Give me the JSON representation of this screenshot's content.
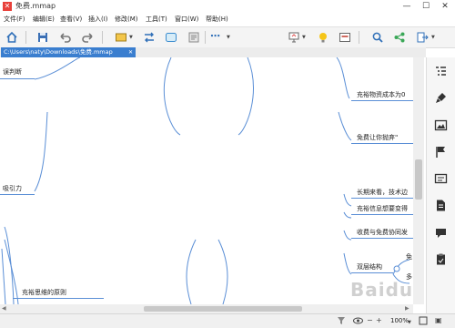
{
  "window": {
    "title": "免费.mmap",
    "minimize": "—",
    "maximize": "☐",
    "close": "✕"
  },
  "menu": [
    "文件(F)",
    "编辑(E)",
    "查看(V)",
    "插入(I)",
    "修改(M)",
    "工具(T)",
    "窗口(W)",
    "帮助(H)"
  ],
  "tab": {
    "path": "C:\\Users\\naty\\Downloads\\免费.mmap",
    "close": "✕"
  },
  "topics": {
    "left": [
      "误判断",
      "吸引力",
      "充裕思维的原则"
    ],
    "right": [
      "充裕物资成本为0",
      "免费让你抛弃\"",
      "长期来看，技术边",
      "充裕信息想要变得",
      "收费与免费协同发",
      "双层结构",
      "免",
      "多"
    ]
  },
  "status": {
    "zoom": "100%",
    "zoom_in": "+",
    "zoom_out": "−"
  },
  "watermark": "Baidu",
  "colors": {
    "accent": "#3a7ecf",
    "branch": "#5b8fd6"
  }
}
